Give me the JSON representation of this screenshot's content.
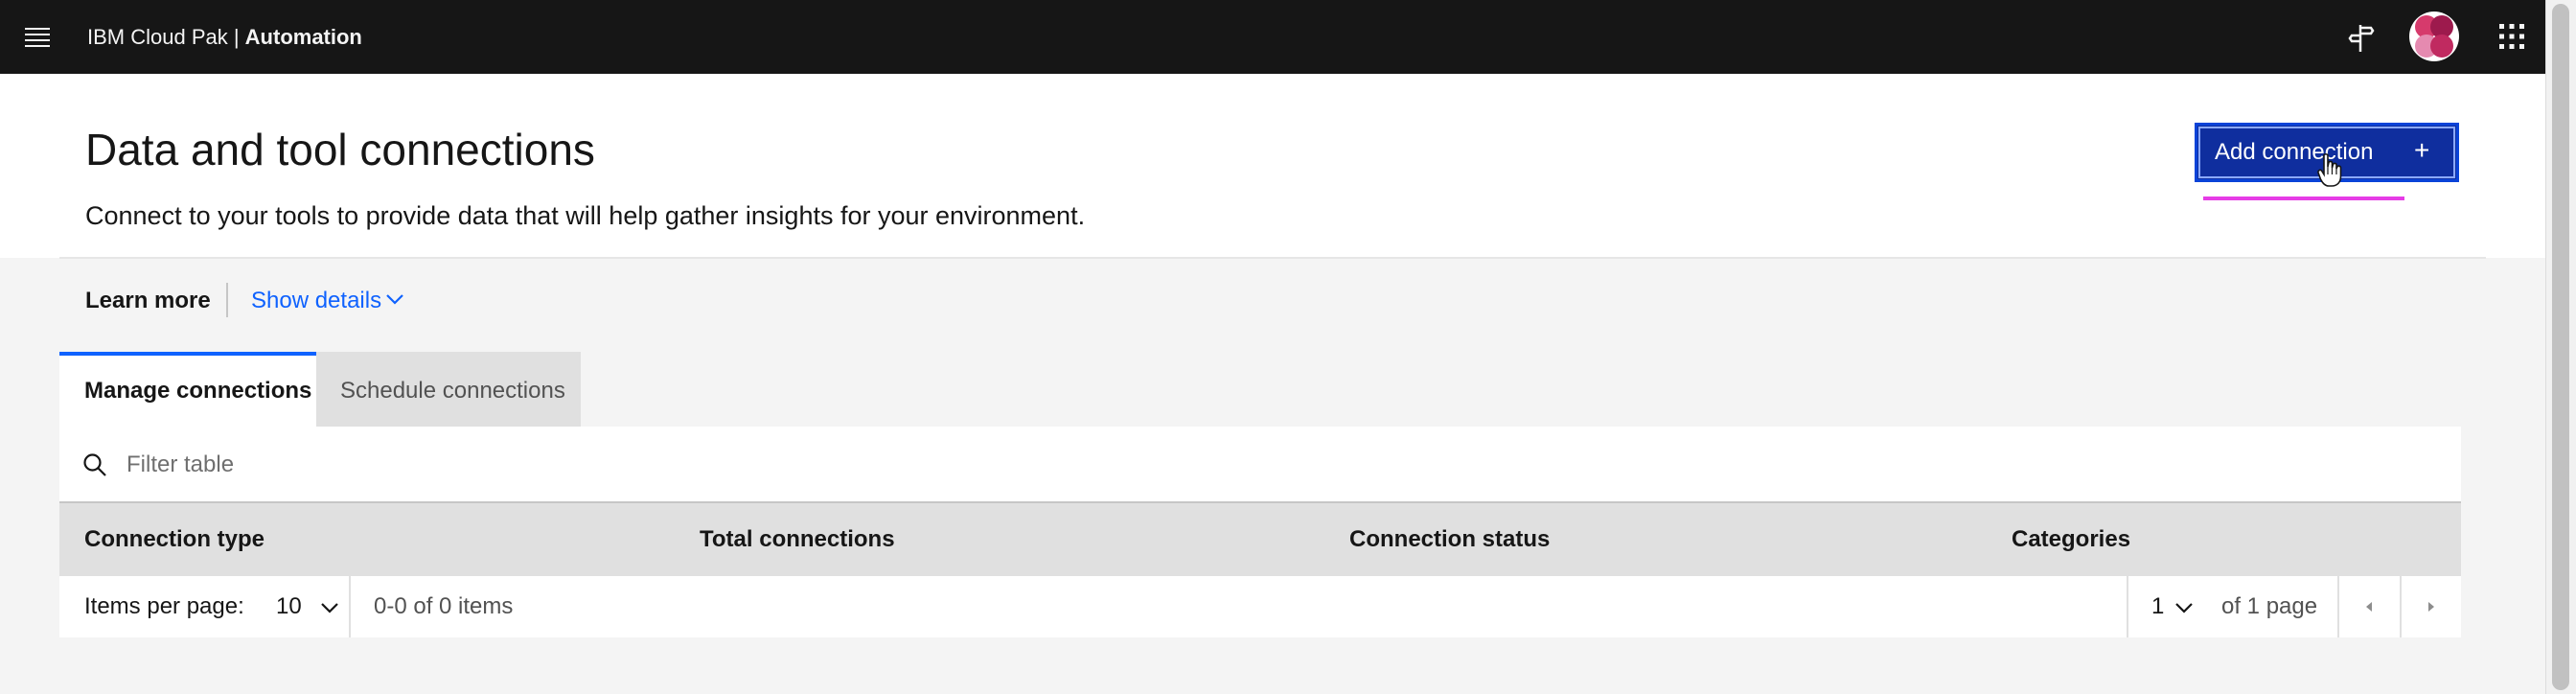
{
  "header": {
    "brand_prefix": "IBM Cloud Pak | ",
    "brand_product": "Automation",
    "icons": [
      "menu-icon",
      "flag-icon",
      "avatar",
      "apps-icon"
    ]
  },
  "hero": {
    "title": "Data and tool connections",
    "subtitle": "Connect to your tools to provide data that will help gather insights for your environment.",
    "add_button": {
      "label": "Add connection",
      "icon": "+"
    }
  },
  "learn": {
    "label": "Learn more",
    "show_details": "Show details"
  },
  "tabs": [
    {
      "label": "Manage connections",
      "selected": true
    },
    {
      "label": "Schedule connections",
      "selected": false
    }
  ],
  "table": {
    "filter_placeholder": "Filter table",
    "columns": [
      "Connection type",
      "Total connections",
      "Connection status",
      "Categories"
    ],
    "rows": []
  },
  "pagination": {
    "items_per_page_label": "Items per page:",
    "items_per_page": "10",
    "range": "0-0 of 0 items",
    "page": "1",
    "of_pages": "of 1 page"
  },
  "colors": {
    "header_bg": "#161616",
    "primary_button": "#0f2e9e",
    "link": "#0f62fe",
    "tab_indicator": "#0f62fe",
    "annotation_underline": "#e63ce6"
  }
}
